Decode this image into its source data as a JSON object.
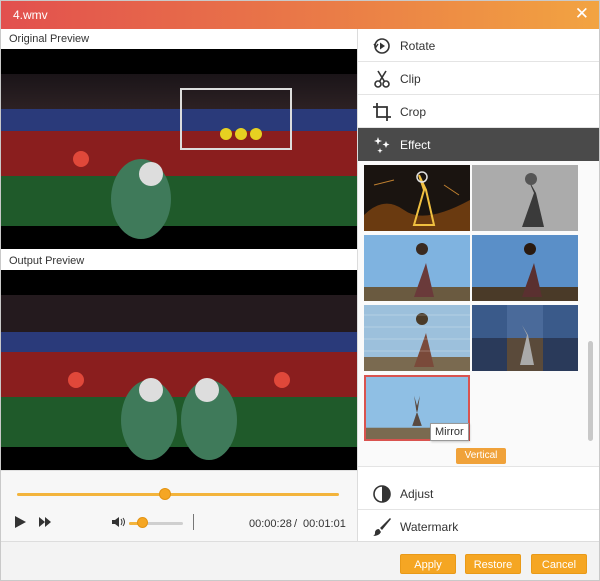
{
  "window": {
    "title": "4.wmv"
  },
  "left": {
    "original_label": "Original Preview",
    "output_label": "Output Preview"
  },
  "player": {
    "progress": 0.46,
    "volume": 0.25,
    "current_time": "00:00:28",
    "separator": "/",
    "total_time": "00:01:01"
  },
  "menu": {
    "items": [
      {
        "label": "Rotate",
        "icon": "rotate-icon"
      },
      {
        "label": "Clip",
        "icon": "scissors-icon"
      },
      {
        "label": "Crop",
        "icon": "crop-icon"
      },
      {
        "label": "Effect",
        "icon": "sparkle-icon",
        "active": true
      },
      {
        "label": "Adjust",
        "icon": "contrast-icon"
      },
      {
        "label": "Watermark",
        "icon": "brush-icon"
      }
    ]
  },
  "effects": {
    "tooltip": "Mirror",
    "vertical_button": "Vertical"
  },
  "buttons": {
    "apply": "Apply",
    "restore": "Restore",
    "cancel": "Cancel"
  },
  "colors": {
    "accent": "#f5a623",
    "title_gradient_start": "#e2504e",
    "title_gradient_end": "#f2a441",
    "active_menu": "#4a4a4a",
    "selected_border": "#d9534f"
  }
}
